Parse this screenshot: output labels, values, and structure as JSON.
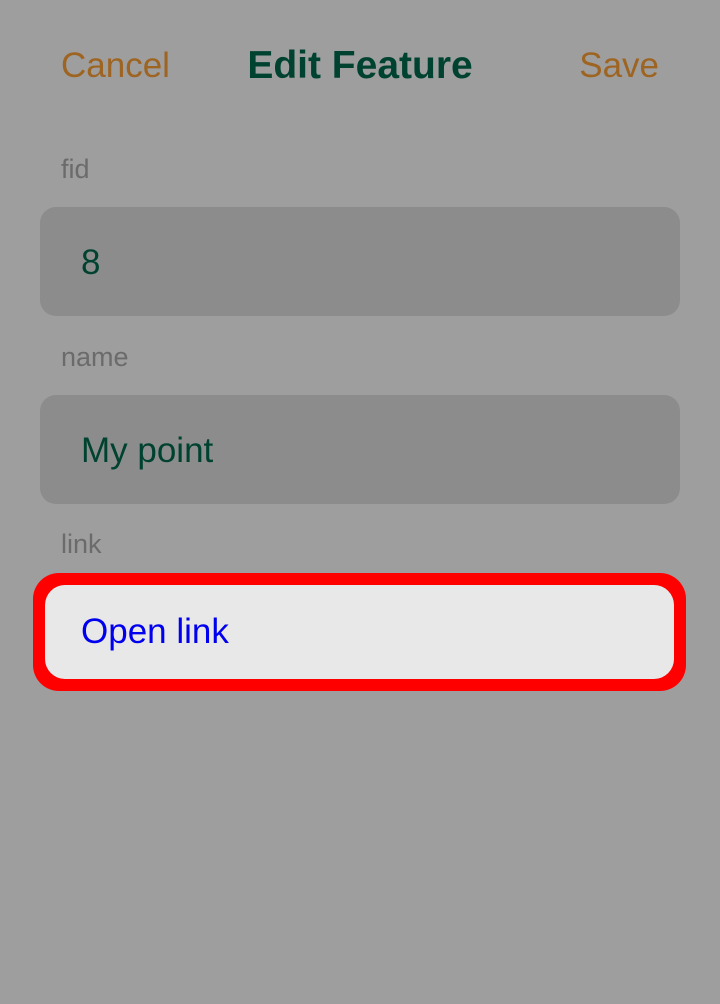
{
  "header": {
    "cancel_label": "Cancel",
    "title": "Edit Feature",
    "save_label": "Save"
  },
  "form": {
    "fields": [
      {
        "label": "fid",
        "value": "8"
      },
      {
        "label": "name",
        "value": "My point"
      },
      {
        "label": "link",
        "value": "Open link"
      }
    ]
  },
  "colors": {
    "overlay_background": "#9e9e9e",
    "header_button": "#9e6421",
    "title": "#004230",
    "field_label": "#6b6b6b",
    "field_background": "#8c8c8c",
    "field_value": "#004230",
    "link_text": "#0000ee",
    "link_background": "#e8e8e8",
    "highlight_border": "#ff0000"
  }
}
